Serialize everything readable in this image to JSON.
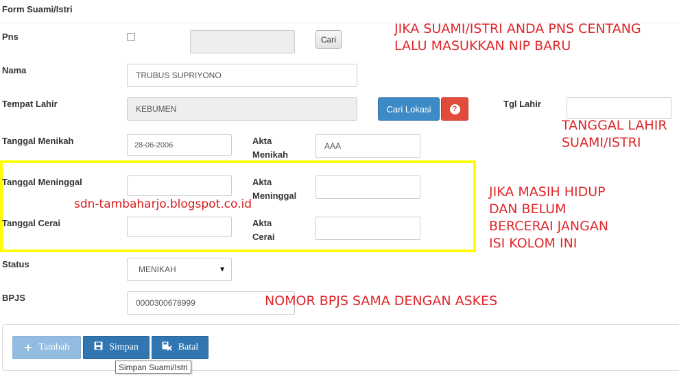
{
  "form_title": "Form Suami/Istri",
  "fields": {
    "pns": {
      "label": "Pns",
      "nip_value": "",
      "search_button": "Cari"
    },
    "nama": {
      "label": "Nama",
      "value": "TRUBUS SUPRIYONO"
    },
    "tempat_lahir": {
      "label": "Tempat Lahir",
      "value": "KEBUMEN",
      "location_button": "Cari Lokasi",
      "help_icon": "question-circle-icon"
    },
    "tgl_lahir": {
      "label": "Tgl Lahir",
      "value": ""
    },
    "tanggal_menikah": {
      "label": "Tanggal Menikah",
      "value": "28-06-2006"
    },
    "akta_menikah": {
      "label_line1": "Akta",
      "label_line2": "Menikah",
      "value": "AAA"
    },
    "tanggal_meninggal": {
      "label": "Tanggal Meninggal",
      "value": ""
    },
    "akta_meninggal": {
      "label_line1": "Akta",
      "label_line2": "Meninggal",
      "value": ""
    },
    "tanggal_cerai": {
      "label": "Tanggal Cerai",
      "value": ""
    },
    "akta_cerai": {
      "label_line1": "Akta",
      "label_line2": "Cerai",
      "value": ""
    },
    "status": {
      "label": "Status",
      "value": "MENIKAH"
    },
    "bpjs": {
      "label": "BPJS",
      "value": "0000300678999"
    }
  },
  "annotations": {
    "pns_note": [
      "JIKA SUAMI/ISTRI ANDA PNS CENTANG",
      "LALU MASUKKAN NIP BARU"
    ],
    "tgl_lahir_note": [
      "TANGGAL LAHIR",
      "SUAMI/ISTRI"
    ],
    "hidup_note": [
      "JIKA MASIH HIDUP",
      "DAN BELUM",
      "BERCERAI JANGAN",
      "ISI KOLOM INI"
    ],
    "bpjs_note": "NOMOR BPJS SAMA DENGAN ASKES",
    "watermark": "sdn-tambaharjo.blogspot.co.id"
  },
  "actions": {
    "tambah": {
      "label": "Tambah",
      "icon": "plus-icon"
    },
    "simpan": {
      "label": "Simpan",
      "icon": "floppy-disk-icon"
    },
    "batal": {
      "label": "Batal",
      "icon": "cancel-edit-icon"
    },
    "tooltip": "Simpan Suami/Istri"
  },
  "colors": {
    "annotation_red": "#e0262a",
    "highlight_yellow": "#ffff00",
    "primary_blue": "#3d8bc6",
    "danger_red": "#e04b3a"
  }
}
